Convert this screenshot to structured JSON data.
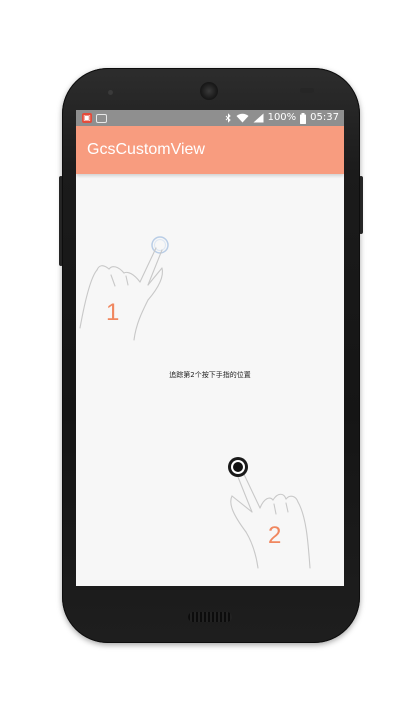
{
  "status_bar": {
    "notification_icon_1": "app-notification-icon",
    "notification_icon_2": "image-notification-icon",
    "battery": "100%",
    "time": "05:37"
  },
  "app_bar": {
    "title": "GcsCustomView"
  },
  "main": {
    "hint_text": "追踪第2个按下手指的位置",
    "finger_1_label": "1",
    "finger_2_label": "2"
  },
  "colors": {
    "accent": "#f89c7f",
    "status_bar": "#8f8f8f",
    "background": "#f7f7f7",
    "finger_label": "#f0875f"
  }
}
